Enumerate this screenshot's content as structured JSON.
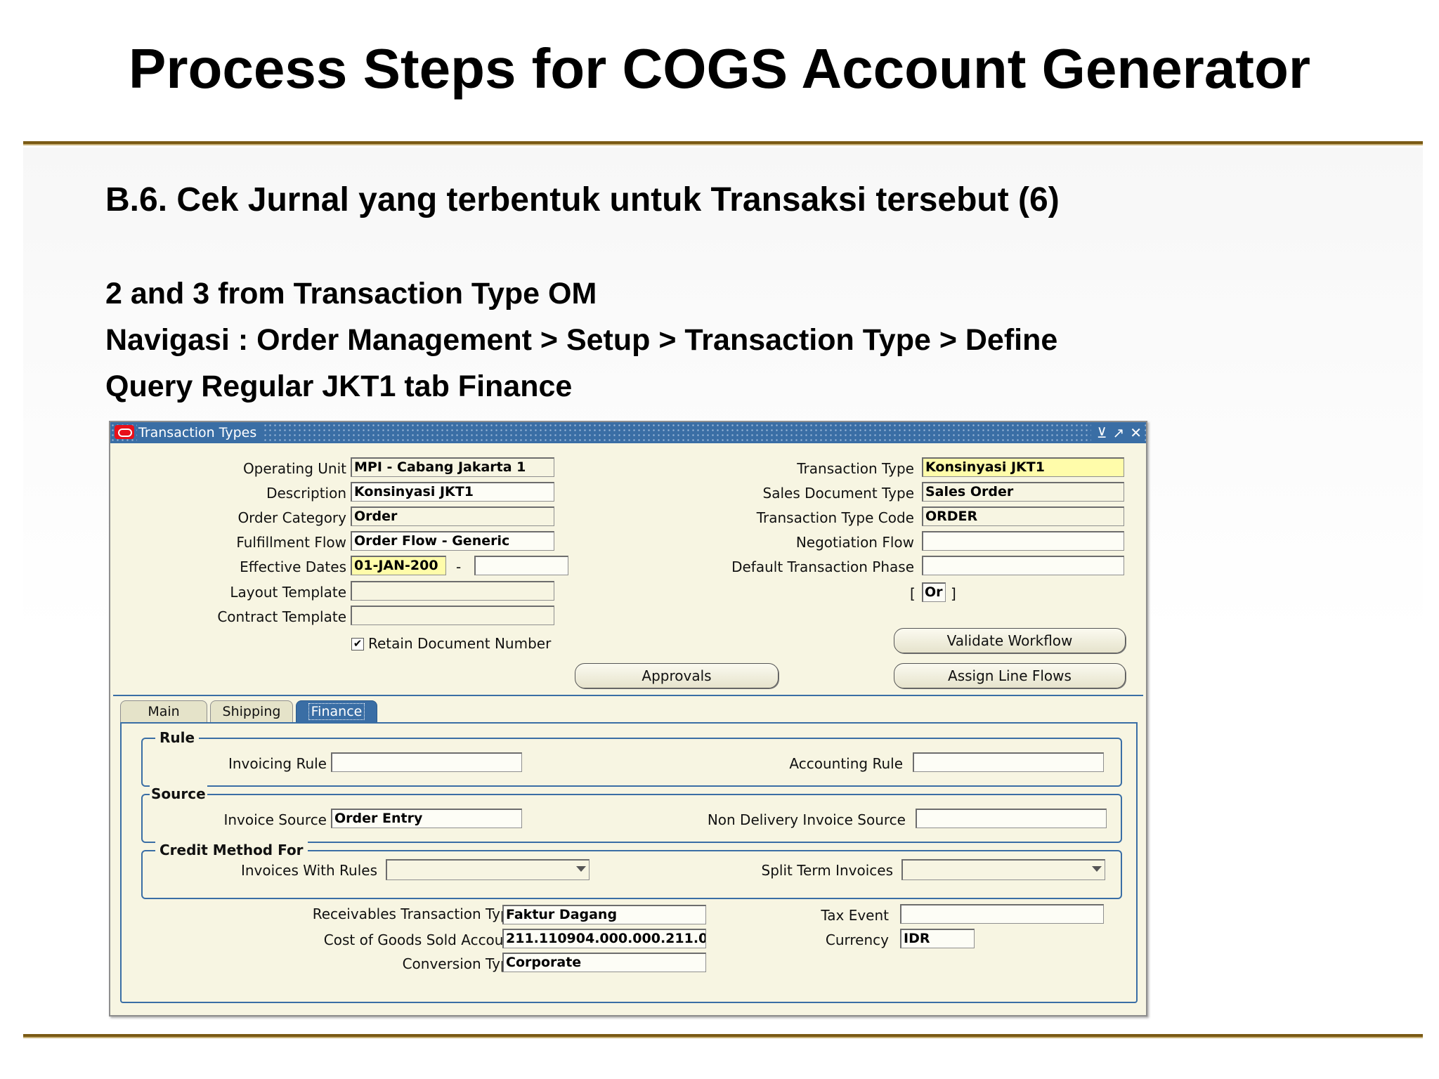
{
  "slide": {
    "title": "Process Steps for COGS Account Generator",
    "heading": "B.6. Cek Jurnal yang terbentuk untuk Transaksi tersebut (6)",
    "lines": [
      "2 and 3 from Transaction Type OM",
      "Navigasi : Order Management > Setup > Transaction Type > Define",
      "Query Regular JKT1 tab Finance"
    ]
  },
  "window": {
    "title": "Transaction Types",
    "controls": {
      "minimize": "⊻",
      "maximize": "↗",
      "close": "✕"
    }
  },
  "header_left": {
    "operating_unit": {
      "label": "Operating Unit",
      "value": "MPI - Cabang Jakarta 1"
    },
    "description": {
      "label": "Description",
      "value": "Konsinyasi JKT1"
    },
    "order_category": {
      "label": "Order Category",
      "value": "Order"
    },
    "fulfillment_flow": {
      "label": "Fulfillment Flow",
      "value": "Order Flow - Generic"
    },
    "effective_dates": {
      "label": "Effective Dates",
      "from": "01-JAN-200",
      "separator": "-",
      "to": ""
    },
    "layout_template": {
      "label": "Layout Template",
      "value": ""
    },
    "contract_template": {
      "label": "Contract Template",
      "value": ""
    },
    "retain_document_number": {
      "label": "Retain Document Number",
      "checked": true,
      "mark": "✔"
    }
  },
  "header_right": {
    "transaction_type": {
      "label": "Transaction Type",
      "value": "Konsinyasi JKT1"
    },
    "sales_document_type": {
      "label": "Sales Document Type",
      "value": "Sales Order"
    },
    "transaction_type_code": {
      "label": "Transaction Type Code",
      "value": "ORDER"
    },
    "negotiation_flow": {
      "label": "Negotiation Flow",
      "value": ""
    },
    "default_transaction_phase": {
      "label": "Default Transaction Phase",
      "value": ""
    },
    "flex": {
      "open": "[",
      "value": "Or",
      "close": "]"
    }
  },
  "buttons": {
    "validate_workflow": "Validate Workflow",
    "approvals": "Approvals",
    "assign_line_flows": "Assign Line  Flows"
  },
  "tabs": [
    "Main",
    "Shipping",
    "Finance"
  ],
  "active_tab": "Finance",
  "finance": {
    "rule": {
      "title": "Rule",
      "invoicing_rule": {
        "label": "Invoicing Rule",
        "value": ""
      },
      "accounting_rule": {
        "label": "Accounting Rule",
        "value": ""
      }
    },
    "source": {
      "title": "Source",
      "invoice_source": {
        "label": "Invoice Source",
        "value": "Order Entry"
      },
      "non_delivery_invoice_source": {
        "label": "Non Delivery Invoice Source",
        "value": ""
      }
    },
    "credit_method": {
      "title": "Credit Method For",
      "invoices_with_rules": {
        "label": "Invoices With Rules",
        "value": ""
      },
      "split_term_invoices": {
        "label": "Split Term Invoices",
        "value": ""
      }
    },
    "receivables_transaction_type": {
      "label": "Receivables Transaction Type",
      "value": "Faktur Dagang"
    },
    "cogs_account": {
      "label": "Cost of Goods Sold Account",
      "value": "211.110904.000.000.211.0"
    },
    "conversion_type": {
      "label": "Conversion Type",
      "value": "Corporate"
    },
    "tax_event": {
      "label": "Tax Event",
      "value": ""
    },
    "currency": {
      "label": "Currency",
      "value": "IDR"
    }
  },
  "colors": {
    "accent": "#3a6ea5",
    "form_bg": "#f7f5e2",
    "required": "#fffcaa",
    "rule": "#7a5a14",
    "oracle_red": "#e8101a"
  }
}
